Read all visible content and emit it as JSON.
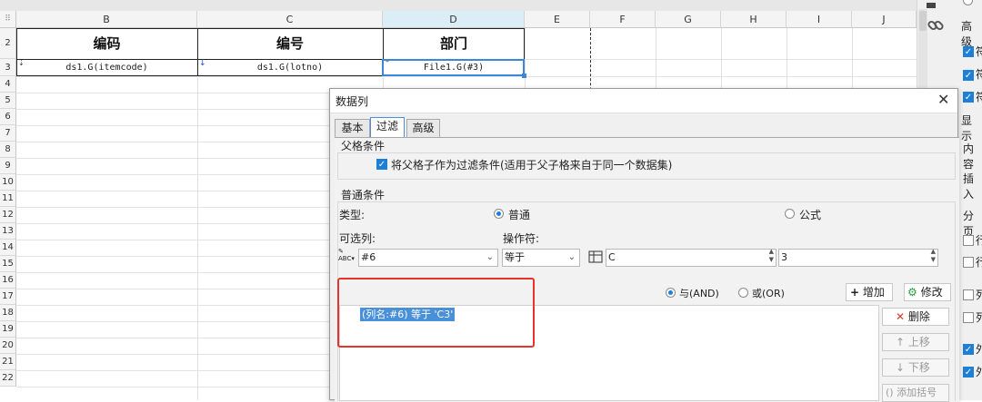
{
  "sheet": {
    "columns": [
      "B",
      "C",
      "D",
      "E",
      "F",
      "G",
      "H",
      "I",
      "J"
    ],
    "rows": [
      "2",
      "3",
      "4",
      "5",
      "6",
      "7",
      "8",
      "9",
      "10",
      "11",
      "12",
      "13",
      "14",
      "15",
      "16",
      "17",
      "18",
      "19",
      "20",
      "21",
      "22"
    ],
    "headers": {
      "b": "编码",
      "c": "编号",
      "d": "部门"
    },
    "cells": {
      "b": "ds1.G(itemcode)",
      "c": "ds1.G(lotno)",
      "d": "File1.G(#3)"
    }
  },
  "right_panel": {
    "label_top": "高级",
    "label_display": "显示",
    "label_content": "内容",
    "label_insert": "插入",
    "label_group": "分页",
    "frag1": "行",
    "frag2": "行",
    "frag3": "列",
    "frag4": "列",
    "frag5": "外",
    "frag6": "外",
    "frag7": "符"
  },
  "dialog": {
    "title": "数据列",
    "close_glyph": "✕",
    "tabs": [
      "基本",
      "过滤",
      "高级"
    ],
    "parent": {
      "group_title": "父格条件",
      "checkbox_label": "将父格子作为过滤条件(适用于父子格来自于同一个数据集)",
      "checked": true
    },
    "common": {
      "group_title": "普通条件",
      "type_label": "类型:",
      "type_normal": "普通",
      "type_formula": "公式",
      "col_label": "可选列:",
      "op_label": "操作符:",
      "col_value": "#6",
      "op_value": "等于",
      "cell_value": "C",
      "num_value": "3",
      "and_label": "与(AND)",
      "or_label": "或(OR)",
      "add_label": "增加",
      "modify_label": "修改",
      "condition_text": "(列名:#6) 等于 'C3'",
      "delete_label": "删除",
      "up_label": "上移",
      "down_label": "下移",
      "bracket_label": "添加括号"
    }
  },
  "colors": {
    "accent": "#1e7fd6",
    "selection": "#3b88db",
    "highlight_box": "#e8322e"
  }
}
